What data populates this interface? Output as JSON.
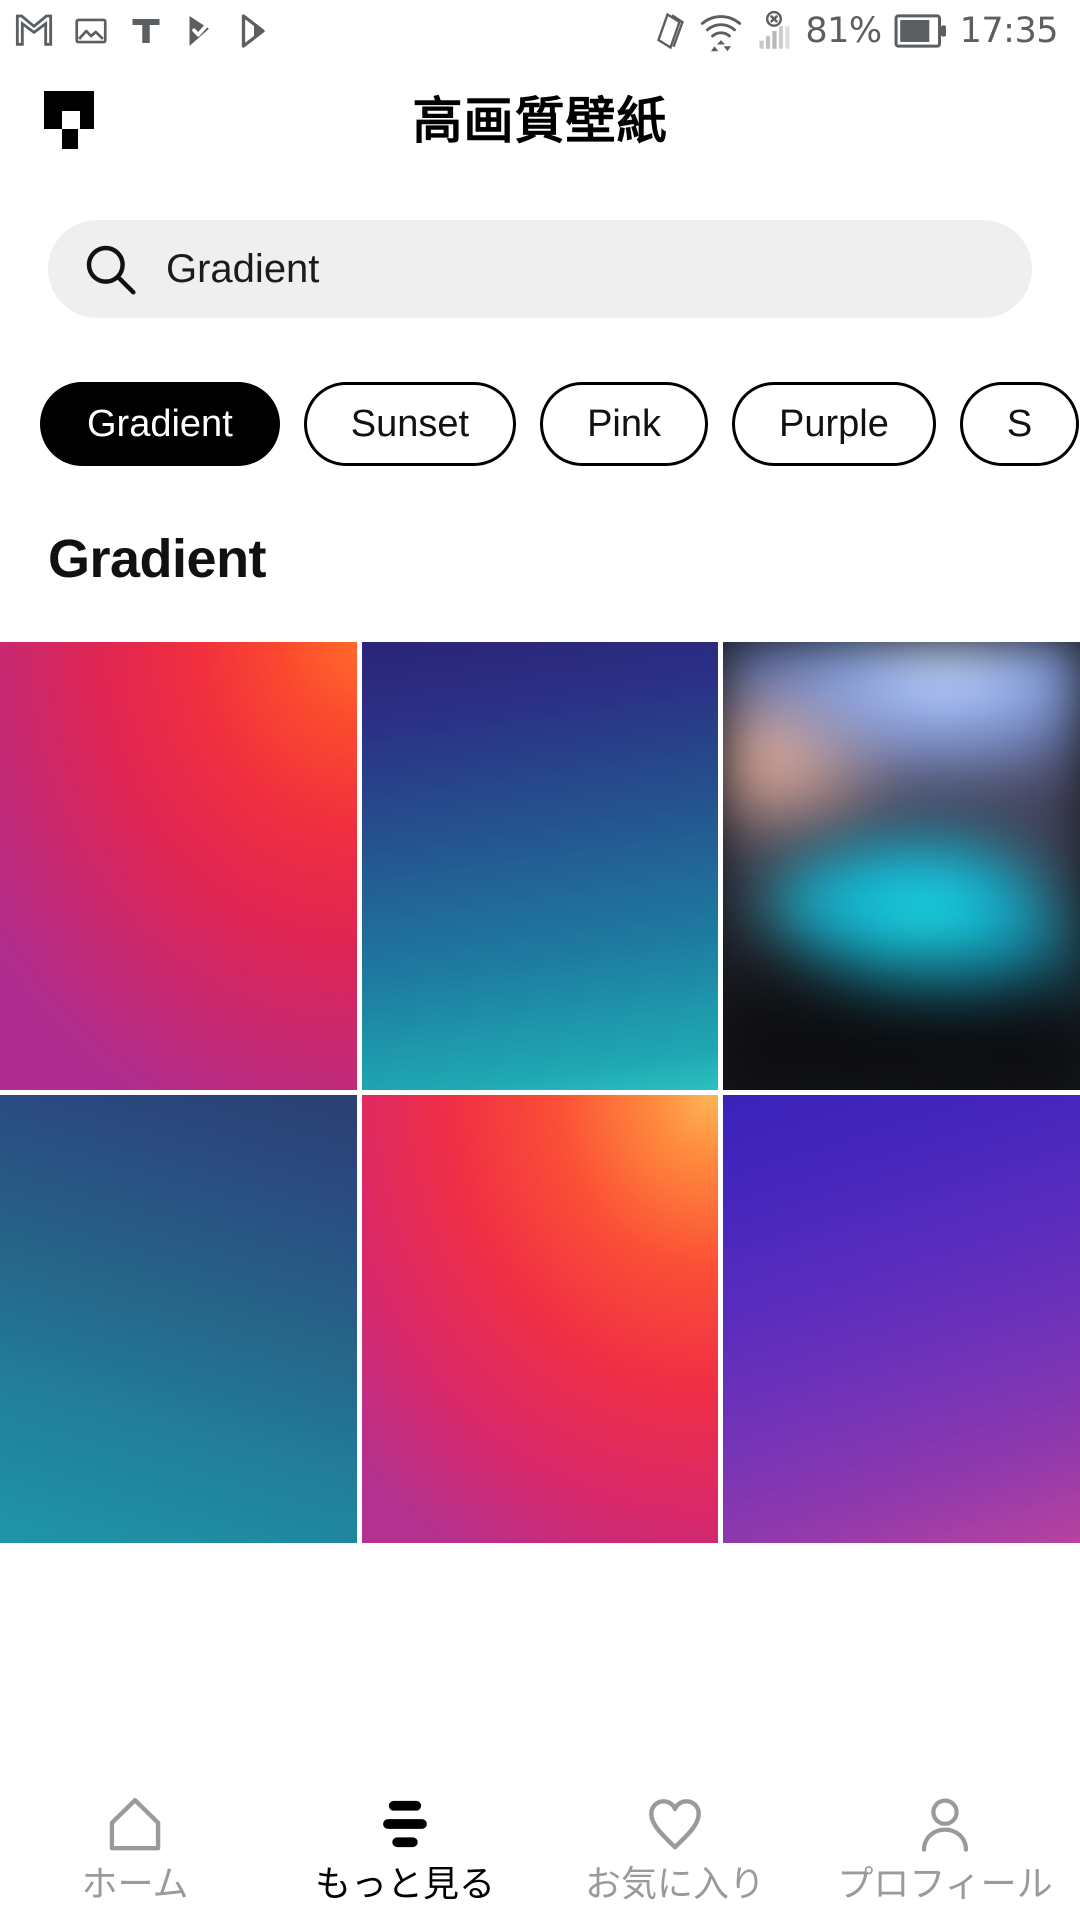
{
  "status_bar": {
    "left_icons": [
      "gmail-icon",
      "photos-icon",
      "text-icon",
      "play-protect-icon",
      "play-store-icon"
    ],
    "right_icons": [
      "screen-rotation-icon",
      "wifi-data-icon",
      "no-sim-signal-icon"
    ],
    "battery_percent": "81%",
    "time": "17:35"
  },
  "header": {
    "logo": "app-logo-icon",
    "title": "高画質壁紙"
  },
  "search": {
    "icon": "search-icon",
    "value": "Gradient",
    "placeholder": "Gradient"
  },
  "chips": [
    {
      "label": "Gradient",
      "selected": true
    },
    {
      "label": "Sunset",
      "selected": false
    },
    {
      "label": "Pink",
      "selected": false
    },
    {
      "label": "Purple",
      "selected": false
    },
    {
      "label": "S",
      "selected": false
    }
  ],
  "section": {
    "title": "Gradient"
  },
  "gallery": {
    "tiles": [
      {
        "name": "wallpaper-red-orange-gradient",
        "style": "tile-g1"
      },
      {
        "name": "wallpaper-navy-teal-gradient",
        "style": "tile-g2"
      },
      {
        "name": "wallpaper-blurred-bokeh-photo",
        "style": "tile-photo"
      },
      {
        "name": "wallpaper-blue-teal-gradient",
        "style": "tile-g3"
      },
      {
        "name": "wallpaper-red-orange-diagonal-gradient",
        "style": "tile-g4"
      },
      {
        "name": "wallpaper-indigo-magenta-gradient",
        "style": "tile-g5"
      }
    ]
  },
  "bottom_nav": {
    "items": [
      {
        "label": "ホーム",
        "icon": "home-icon",
        "active": false
      },
      {
        "label": "もっと見る",
        "icon": "more-list-icon",
        "active": true
      },
      {
        "label": "お気に入り",
        "icon": "heart-icon",
        "active": false
      },
      {
        "label": "プロフィール",
        "icon": "person-icon",
        "active": false
      }
    ]
  },
  "colors": {
    "accent": "#000000",
    "search_background": "#efefef",
    "inactive_nav": "#9a9a9a",
    "status_icon": "#5b5f62"
  }
}
